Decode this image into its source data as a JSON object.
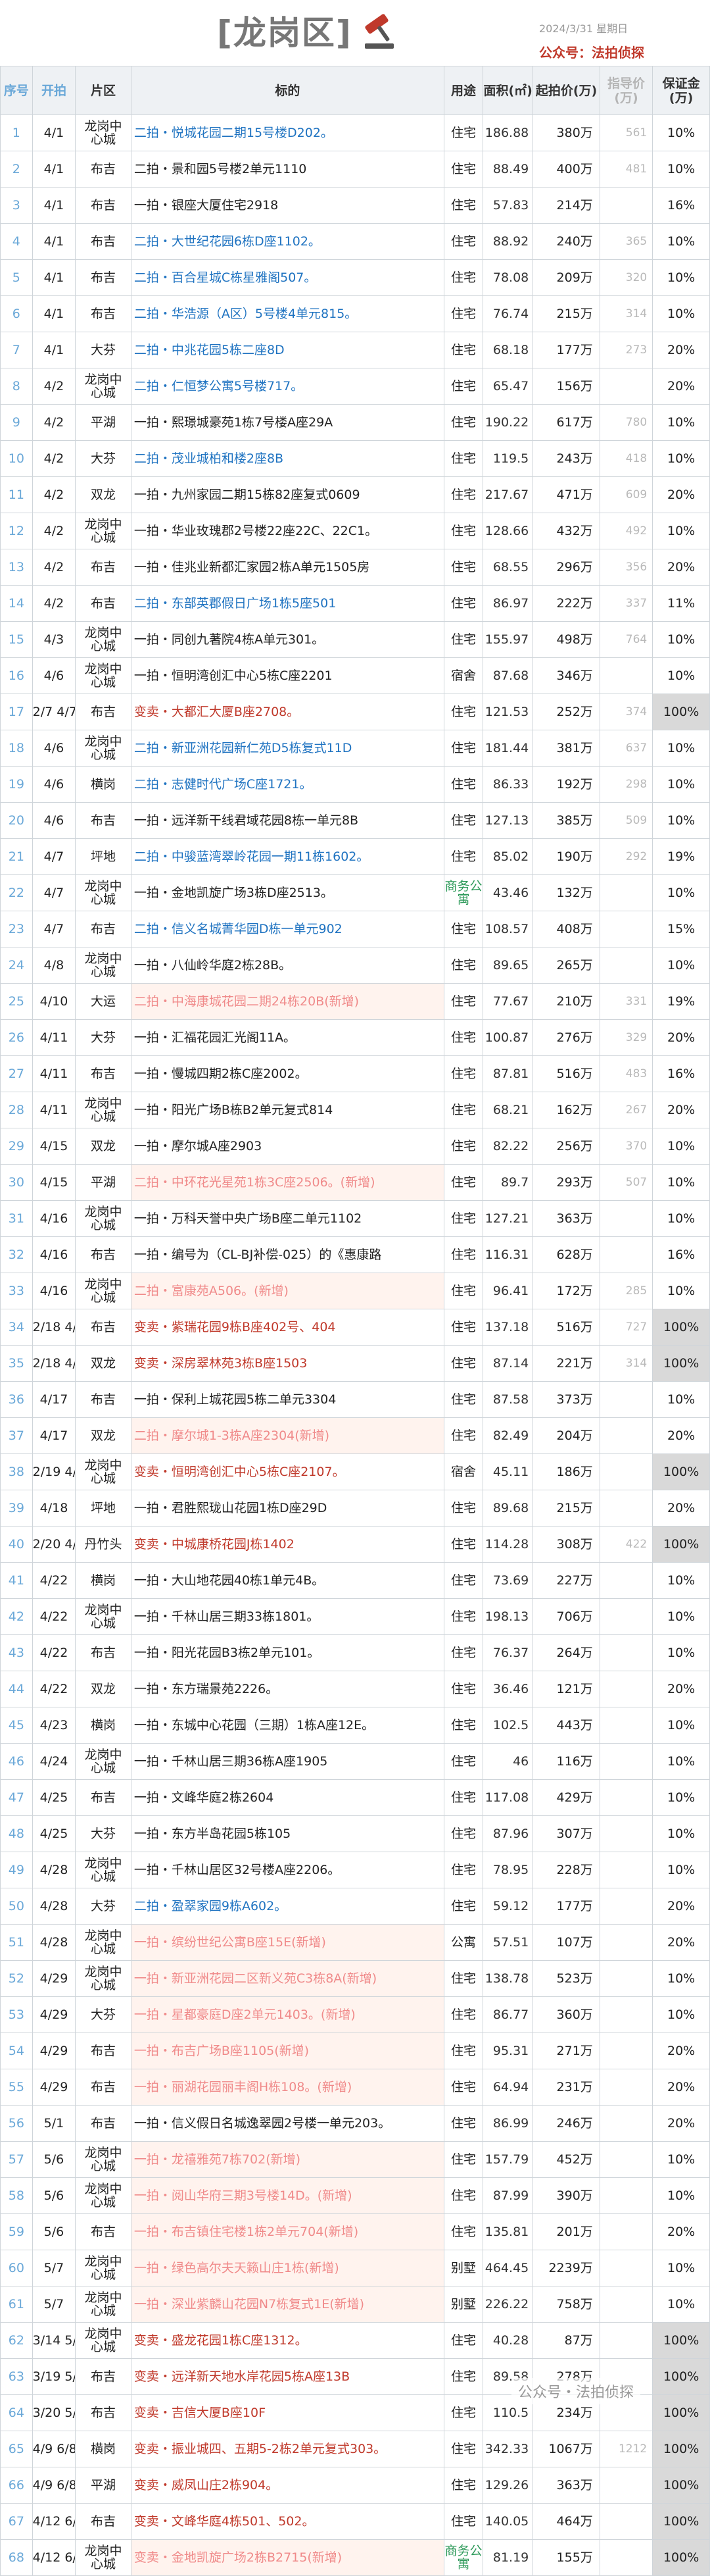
{
  "header": {
    "title": "[龙岗区]",
    "date": "2024/3/31 星期日",
    "publisher": "公众号：法拍侦探"
  },
  "columns": {
    "seq": "序号",
    "start": "开拍",
    "zone": "片区",
    "target": "标的",
    "use": "用途",
    "area": "面积(㎡)",
    "price": "起拍价(万)",
    "prev": "指导价(万)",
    "deposit": "保证金(万)"
  },
  "rows": [
    {
      "seq": "1",
      "start": "4/1",
      "zone": "龙岗中心城",
      "target": "二拍・悦城花园二期15号楼D202。",
      "type": "blue",
      "use": "住宅",
      "area": "186.88",
      "price": "380万",
      "prev": "561",
      "dep": "10%"
    },
    {
      "seq": "2",
      "start": "4/1",
      "zone": "布吉",
      "target": "二拍・景和园5号楼2单元1110",
      "type": "black",
      "use": "住宅",
      "area": "88.49",
      "price": "400万",
      "prev": "481",
      "dep": "10%"
    },
    {
      "seq": "3",
      "start": "4/1",
      "zone": "布吉",
      "target": "一拍・银座大厦住宅2918",
      "type": "black",
      "use": "住宅",
      "area": "57.83",
      "price": "214万",
      "prev": "",
      "dep": "16%"
    },
    {
      "seq": "4",
      "start": "4/1",
      "zone": "布吉",
      "target": "二拍・大世纪花园6栋D座1102。",
      "type": "blue",
      "use": "住宅",
      "area": "88.92",
      "price": "240万",
      "prev": "365",
      "dep": "10%"
    },
    {
      "seq": "5",
      "start": "4/1",
      "zone": "布吉",
      "target": "二拍・百合星城C栋星雅阁507。",
      "type": "blue",
      "use": "住宅",
      "area": "78.08",
      "price": "209万",
      "prev": "320",
      "dep": "10%"
    },
    {
      "seq": "6",
      "start": "4/1",
      "zone": "布吉",
      "target": "二拍・华浩源（A区）5号楼4单元815。",
      "type": "blue",
      "use": "住宅",
      "area": "76.74",
      "price": "215万",
      "prev": "314",
      "dep": "10%"
    },
    {
      "seq": "7",
      "start": "4/1",
      "zone": "大芬",
      "target": "二拍・中兆花园5栋二座8D",
      "type": "blue",
      "use": "住宅",
      "area": "68.18",
      "price": "177万",
      "prev": "273",
      "dep": "20%"
    },
    {
      "seq": "8",
      "start": "4/2",
      "zone": "龙岗中心城",
      "target": "二拍・仁恒梦公寓5号楼717。",
      "type": "blue",
      "use": "住宅",
      "area": "65.47",
      "price": "156万",
      "prev": "",
      "dep": "20%"
    },
    {
      "seq": "9",
      "start": "4/2",
      "zone": "平湖",
      "target": "一拍・熙璟城豪苑1栋7号楼A座29A",
      "type": "black",
      "use": "住宅",
      "area": "190.22",
      "price": "617万",
      "prev": "780",
      "dep": "10%"
    },
    {
      "seq": "10",
      "start": "4/2",
      "zone": "大芬",
      "target": "二拍・茂业城柏和楼2座8B",
      "type": "blue",
      "use": "住宅",
      "area": "119.5",
      "price": "243万",
      "prev": "418",
      "dep": "10%"
    },
    {
      "seq": "11",
      "start": "4/2",
      "zone": "双龙",
      "target": "一拍・九州家园二期15栋82座复式0609",
      "type": "black",
      "use": "住宅",
      "area": "217.67",
      "price": "471万",
      "prev": "609",
      "dep": "20%"
    },
    {
      "seq": "12",
      "start": "4/2",
      "zone": "龙岗中心城",
      "target": "一拍・华业玫瑰郡2号楼22座22C、22C1。",
      "type": "black",
      "use": "住宅",
      "area": "128.66",
      "price": "432万",
      "prev": "492",
      "dep": "10%"
    },
    {
      "seq": "13",
      "start": "4/2",
      "zone": "布吉",
      "target": "一拍・佳兆业新都汇家园2栋A单元1505房",
      "type": "black",
      "use": "住宅",
      "area": "68.55",
      "price": "296万",
      "prev": "356",
      "dep": "20%"
    },
    {
      "seq": "14",
      "start": "4/2",
      "zone": "布吉",
      "target": "二拍・东部英郡假日广场1栋5座501",
      "type": "blue",
      "use": "住宅",
      "area": "86.97",
      "price": "222万",
      "prev": "337",
      "dep": "11%"
    },
    {
      "seq": "15",
      "start": "4/3",
      "zone": "龙岗中心城",
      "target": "一拍・同创九著院4栋A单元301。",
      "type": "black",
      "use": "住宅",
      "area": "155.97",
      "price": "498万",
      "prev": "764",
      "dep": "10%"
    },
    {
      "seq": "16",
      "start": "4/6",
      "zone": "龙岗中心城",
      "target": "一拍・恒明湾创汇中心5栋C座2201",
      "type": "black",
      "use": "宿舍",
      "area": "87.68",
      "price": "346万",
      "prev": "",
      "dep": "10%"
    },
    {
      "seq": "17",
      "start": "2/7 4/7",
      "zone": "布吉",
      "target": "变卖・大都汇大厦B座2708。",
      "type": "red",
      "use": "住宅",
      "area": "121.53",
      "price": "252万",
      "prev": "374",
      "dep": "100%",
      "big": true
    },
    {
      "seq": "18",
      "start": "4/6",
      "zone": "龙岗中心城",
      "target": "二拍・新亚洲花园新仁苑D5栋复式11D",
      "type": "blue",
      "use": "住宅",
      "area": "181.44",
      "price": "381万",
      "prev": "637",
      "dep": "10%"
    },
    {
      "seq": "19",
      "start": "4/6",
      "zone": "横岗",
      "target": "二拍・志健时代广场C座1721。",
      "type": "blue",
      "use": "住宅",
      "area": "86.33",
      "price": "192万",
      "prev": "298",
      "dep": "10%"
    },
    {
      "seq": "20",
      "start": "4/6",
      "zone": "布吉",
      "target": "一拍・远洋新干线君域花园8栋一单元8B",
      "type": "black",
      "use": "住宅",
      "area": "127.13",
      "price": "385万",
      "prev": "509",
      "dep": "10%"
    },
    {
      "seq": "21",
      "start": "4/7",
      "zone": "坪地",
      "target": "二拍・中骏蓝湾翠岭花园一期11栋1602。",
      "type": "blue",
      "use": "住宅",
      "area": "85.02",
      "price": "190万",
      "prev": "292",
      "dep": "19%"
    },
    {
      "seq": "22",
      "start": "4/7",
      "zone": "龙岗中心城",
      "target": "一拍・金地凯旋广场3栋D座2513。",
      "type": "black",
      "use": "商务公寓",
      "area": "43.46",
      "price": "132万",
      "prev": "",
      "dep": "10%"
    },
    {
      "seq": "23",
      "start": "4/7",
      "zone": "布吉",
      "target": "二拍・信义名城菁华园D栋一单元902",
      "type": "blue",
      "use": "住宅",
      "area": "108.57",
      "price": "408万",
      "prev": "",
      "dep": "15%"
    },
    {
      "seq": "24",
      "start": "4/8",
      "zone": "龙岗中心城",
      "target": "一拍・八仙岭华庭2栋28B。",
      "type": "black",
      "use": "住宅",
      "area": "89.65",
      "price": "265万",
      "prev": "",
      "dep": "10%"
    },
    {
      "seq": "25",
      "start": "4/10",
      "zone": "大运",
      "target": "二拍・中海康城花园二期24栋20B(新增)",
      "type": "pink",
      "use": "住宅",
      "area": "77.67",
      "price": "210万",
      "prev": "331",
      "dep": "19%"
    },
    {
      "seq": "26",
      "start": "4/11",
      "zone": "大芬",
      "target": "一拍・汇福花园汇光阁11A。",
      "type": "black",
      "use": "住宅",
      "area": "100.87",
      "price": "276万",
      "prev": "329",
      "dep": "20%"
    },
    {
      "seq": "27",
      "start": "4/11",
      "zone": "布吉",
      "target": "一拍・慢城四期2栋C座2002。",
      "type": "black",
      "use": "住宅",
      "area": "87.81",
      "price": "516万",
      "prev": "483",
      "dep": "16%"
    },
    {
      "seq": "28",
      "start": "4/11",
      "zone": "龙岗中心城",
      "target": "一拍・阳光广场B栋B2单元复式814",
      "type": "black",
      "use": "住宅",
      "area": "68.21",
      "price": "162万",
      "prev": "267",
      "dep": "20%"
    },
    {
      "seq": "29",
      "start": "4/15",
      "zone": "双龙",
      "target": "一拍・摩尔城A座2903",
      "type": "black",
      "use": "住宅",
      "area": "82.22",
      "price": "256万",
      "prev": "370",
      "dep": "10%"
    },
    {
      "seq": "30",
      "start": "4/15",
      "zone": "平湖",
      "target": "二拍・中环花光星苑1栋3C座2506。(新增)",
      "type": "pink",
      "use": "住宅",
      "area": "89.7",
      "price": "293万",
      "prev": "507",
      "dep": "10%"
    },
    {
      "seq": "31",
      "start": "4/16",
      "zone": "龙岗中心城",
      "target": "一拍・万科天誉中央广场B座二单元1102",
      "type": "black",
      "use": "住宅",
      "area": "127.21",
      "price": "363万",
      "prev": "",
      "dep": "10%"
    },
    {
      "seq": "32",
      "start": "4/16",
      "zone": "布吉",
      "target": "一拍・编号为（CL-BJ补偿-025）的《惠康路",
      "type": "black",
      "use": "住宅",
      "area": "116.31",
      "price": "628万",
      "prev": "",
      "dep": "16%"
    },
    {
      "seq": "33",
      "start": "4/16",
      "zone": "龙岗中心城",
      "target": "二拍・富康苑A506。(新增)",
      "type": "pink",
      "use": "住宅",
      "area": "96.41",
      "price": "172万",
      "prev": "285",
      "dep": "10%"
    },
    {
      "seq": "34",
      "start": "2/18 4/18",
      "zone": "布吉",
      "target": "变卖・紫瑞花园9栋B座402号、404",
      "type": "red",
      "use": "住宅",
      "area": "137.18",
      "price": "516万",
      "prev": "727",
      "dep": "100%",
      "big": true
    },
    {
      "seq": "35",
      "start": "2/18 4/18",
      "zone": "双龙",
      "target": "变卖・深房翠林苑3栋B座1503",
      "type": "red",
      "use": "住宅",
      "area": "87.14",
      "price": "221万",
      "prev": "314",
      "dep": "100%",
      "big": true
    },
    {
      "seq": "36",
      "start": "4/17",
      "zone": "布吉",
      "target": "一拍・保利上城花园5栋二单元3304",
      "type": "black",
      "use": "住宅",
      "area": "87.58",
      "price": "373万",
      "prev": "",
      "dep": "10%"
    },
    {
      "seq": "37",
      "start": "4/17",
      "zone": "双龙",
      "target": "二拍・摩尔城1-3栋A座2304(新增)",
      "type": "pink",
      "use": "住宅",
      "area": "82.49",
      "price": "204万",
      "prev": "",
      "dep": "20%"
    },
    {
      "seq": "38",
      "start": "2/19 4/19",
      "zone": "龙岗中心城",
      "target": "变卖・恒明湾创汇中心5栋C座2107。",
      "type": "red",
      "use": "宿舍",
      "area": "45.11",
      "price": "186万",
      "prev": "",
      "dep": "100%",
      "big": true
    },
    {
      "seq": "39",
      "start": "4/18",
      "zone": "坪地",
      "target": "一拍・君胜熙珑山花园1栋D座29D",
      "type": "black",
      "use": "住宅",
      "area": "89.68",
      "price": "215万",
      "prev": "",
      "dep": "20%"
    },
    {
      "seq": "40",
      "start": "2/20 4/20",
      "zone": "丹竹头",
      "target": "变卖・中城康桥花园J栋1402",
      "type": "red",
      "use": "住宅",
      "area": "114.28",
      "price": "308万",
      "prev": "422",
      "dep": "100%",
      "big": true
    },
    {
      "seq": "41",
      "start": "4/22",
      "zone": "横岗",
      "target": "一拍・大山地花园40栋1单元4B。",
      "type": "black",
      "use": "住宅",
      "area": "73.69",
      "price": "227万",
      "prev": "",
      "dep": "10%"
    },
    {
      "seq": "42",
      "start": "4/22",
      "zone": "龙岗中心城",
      "target": "一拍・千林山居三期33栋1801。",
      "type": "black",
      "use": "住宅",
      "area": "198.13",
      "price": "706万",
      "prev": "",
      "dep": "10%"
    },
    {
      "seq": "43",
      "start": "4/22",
      "zone": "布吉",
      "target": "一拍・阳光花园B3栋2单元101。",
      "type": "black",
      "use": "住宅",
      "area": "76.37",
      "price": "264万",
      "prev": "",
      "dep": "10%"
    },
    {
      "seq": "44",
      "start": "4/22",
      "zone": "双龙",
      "target": "一拍・东方瑞景苑2226。",
      "type": "black",
      "use": "住宅",
      "area": "36.46",
      "price": "121万",
      "prev": "",
      "dep": "20%"
    },
    {
      "seq": "45",
      "start": "4/23",
      "zone": "横岗",
      "target": "一拍・东城中心花园（三期）1栋A座12E。",
      "type": "black",
      "use": "住宅",
      "area": "102.5",
      "price": "443万",
      "prev": "",
      "dep": "10%"
    },
    {
      "seq": "46",
      "start": "4/24",
      "zone": "龙岗中心城",
      "target": "一拍・千林山居三期36栋A座1905",
      "type": "black",
      "use": "住宅",
      "area": "46",
      "price": "116万",
      "prev": "",
      "dep": "10%"
    },
    {
      "seq": "47",
      "start": "4/25",
      "zone": "布吉",
      "target": "一拍・文峰华庭2栋2604",
      "type": "black",
      "use": "住宅",
      "area": "117.08",
      "price": "429万",
      "prev": "",
      "dep": "10%"
    },
    {
      "seq": "48",
      "start": "4/25",
      "zone": "大芬",
      "target": "一拍・东方半岛花园5栋105",
      "type": "black",
      "use": "住宅",
      "area": "87.96",
      "price": "307万",
      "prev": "",
      "dep": "10%"
    },
    {
      "seq": "49",
      "start": "4/28",
      "zone": "龙岗中心城",
      "target": "一拍・千林山居区32号楼A座2206。",
      "type": "black",
      "use": "住宅",
      "area": "78.95",
      "price": "228万",
      "prev": "",
      "dep": "10%"
    },
    {
      "seq": "50",
      "start": "4/28",
      "zone": "大芬",
      "target": "二拍・盈翠家园9栋A602。",
      "type": "blue",
      "use": "住宅",
      "area": "59.12",
      "price": "177万",
      "prev": "",
      "dep": "20%"
    },
    {
      "seq": "51",
      "start": "4/28",
      "zone": "龙岗中心城",
      "target": "一拍・缤纷世纪公寓B座15E(新增)",
      "type": "pink",
      "use": "公寓",
      "area": "57.51",
      "price": "107万",
      "prev": "",
      "dep": "20%"
    },
    {
      "seq": "52",
      "start": "4/29",
      "zone": "龙岗中心城",
      "target": "一拍・新亚洲花园二区新义苑C3栋8A(新增)",
      "type": "pink",
      "use": "住宅",
      "area": "138.78",
      "price": "523万",
      "prev": "",
      "dep": "10%"
    },
    {
      "seq": "53",
      "start": "4/29",
      "zone": "大芬",
      "target": "一拍・星都豪庭D座2单元1403。(新增)",
      "type": "pink",
      "use": "住宅",
      "area": "86.77",
      "price": "360万",
      "prev": "",
      "dep": "10%"
    },
    {
      "seq": "54",
      "start": "4/29",
      "zone": "布吉",
      "target": "一拍・布吉广场B座1105(新增)",
      "type": "pink",
      "use": "住宅",
      "area": "95.31",
      "price": "271万",
      "prev": "",
      "dep": "20%"
    },
    {
      "seq": "55",
      "start": "4/29",
      "zone": "布吉",
      "target": "一拍・丽湖花园丽丰阁H栋108。(新增)",
      "type": "pink",
      "use": "住宅",
      "area": "64.94",
      "price": "231万",
      "prev": "",
      "dep": "20%"
    },
    {
      "seq": "56",
      "start": "5/1",
      "zone": "布吉",
      "target": "一拍・信义假日名城逸翠园2号楼一单元203。",
      "type": "black",
      "use": "住宅",
      "area": "86.99",
      "price": "246万",
      "prev": "",
      "dep": "20%"
    },
    {
      "seq": "57",
      "start": "5/6",
      "zone": "龙岗中心城",
      "target": "一拍・龙禧雅苑7栋702(新增)",
      "type": "pink",
      "use": "住宅",
      "area": "157.79",
      "price": "452万",
      "prev": "",
      "dep": "10%"
    },
    {
      "seq": "58",
      "start": "5/6",
      "zone": "龙岗中心城",
      "target": "一拍・阅山华府三期3号楼14D。(新增)",
      "type": "pink",
      "use": "住宅",
      "area": "87.99",
      "price": "390万",
      "prev": "",
      "dep": "10%"
    },
    {
      "seq": "59",
      "start": "5/6",
      "zone": "布吉",
      "target": "一拍・布吉镇住宅楼1栋2单元704(新增)",
      "type": "pink",
      "use": "住宅",
      "area": "135.81",
      "price": "201万",
      "prev": "",
      "dep": "20%"
    },
    {
      "seq": "60",
      "start": "5/7",
      "zone": "龙岗中心城",
      "target": "一拍・绿色高尔夫天籁山庄1栋(新增)",
      "type": "pink",
      "use": "别墅",
      "area": "464.45",
      "price": "2239万",
      "prev": "",
      "dep": "10%"
    },
    {
      "seq": "61",
      "start": "5/7",
      "zone": "龙岗中心城",
      "target": "一拍・深业紫麟山花园N7栋复式1E(新增)",
      "type": "pink",
      "use": "别墅",
      "area": "226.22",
      "price": "758万",
      "prev": "",
      "dep": "10%"
    },
    {
      "seq": "62",
      "start": "3/14 5/13",
      "zone": "龙岗中心城",
      "target": "变卖・盛龙花园1栋C座1312。",
      "type": "red",
      "use": "住宅",
      "area": "40.28",
      "price": "87万",
      "prev": "",
      "dep": "100%",
      "big": true
    },
    {
      "seq": "63",
      "start": "3/19 5/18",
      "zone": "布吉",
      "target": "变卖・远洋新天地水岸花园5栋A座13B",
      "type": "red",
      "use": "住宅",
      "area": "89.58",
      "price": "278万",
      "prev": "",
      "dep": "100%",
      "big": true
    },
    {
      "seq": "64",
      "start": "3/20 5/19",
      "zone": "布吉",
      "target": "变卖・吉信大厦B座10F",
      "type": "red",
      "use": "住宅",
      "area": "110.5",
      "price": "234万",
      "prev": "",
      "dep": "100%",
      "big": true
    },
    {
      "seq": "65",
      "start": "4/9 6/8",
      "zone": "横岗",
      "target": "变卖・振业城四、五期5-2栋2单元复式303。",
      "type": "red",
      "use": "住宅",
      "area": "342.33",
      "price": "1067万",
      "prev": "1212",
      "dep": "100%",
      "big": true
    },
    {
      "seq": "66",
      "start": "4/9 6/8",
      "zone": "平湖",
      "target": "变卖・威凤山庄2栋904。",
      "type": "red",
      "use": "住宅",
      "area": "129.26",
      "price": "363万",
      "prev": "",
      "dep": "100%",
      "big": true
    },
    {
      "seq": "67",
      "start": "4/12 6/11",
      "zone": "布吉",
      "target": "变卖・文峰华庭4栋501、502。",
      "type": "red",
      "use": "住宅",
      "area": "140.05",
      "price": "464万",
      "prev": "",
      "dep": "100%",
      "big": true
    },
    {
      "seq": "68",
      "start": "4/12 6/11",
      "zone": "龙岗中心城",
      "target": "变卖・金地凯旋广场2栋B2715(新增)",
      "type": "pink",
      "use": "商务公寓",
      "area": "81.19",
      "price": "155万",
      "prev": "",
      "dep": "100%",
      "big": true
    }
  ],
  "watermark": "公众号・法拍侦探"
}
